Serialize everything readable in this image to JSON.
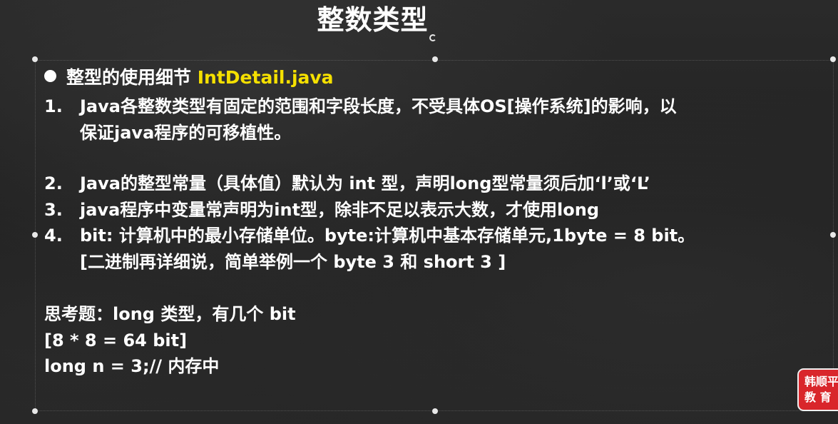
{
  "slide": {
    "title": "整数类型",
    "bullet": {
      "label": "整型的使用细节",
      "file": "IntDetail.java"
    },
    "items": [
      {
        "num": "1.",
        "line1": "Java各整数类型有固定的范围和字段长度，不受具体OS[操作系统]的影响，以",
        "line2": "保证java程序的可移植性。"
      },
      {
        "num": "2.",
        "line1": "Java的整型常量（具体值）默认为 int 型，声明long型常量须后加‘l’或‘L’"
      },
      {
        "num": "3.",
        "line1": "java程序中变量常声明为int型，除非不足以表示大数，才使用long"
      },
      {
        "num": "4.",
        "line1": "bit: 计算机中的最小存储单位。byte:计算机中基本存储单元,1byte = 8 bit。",
        "line2": "[二进制再详细说，简单举例一个 byte 3 和 short 3 ]"
      }
    ],
    "question": "思考题：long 类型，有几个 bit",
    "answer1": "[8 * 8 = 64 bit]",
    "answer2": "long n = 3;// 内存中",
    "logo": {
      "line1": "韩顺平",
      "line2": "教 育"
    }
  },
  "colors": {
    "background": "#232323",
    "text": "#ffffff",
    "highlight": "#f5e000",
    "logo": "#d9262b"
  }
}
